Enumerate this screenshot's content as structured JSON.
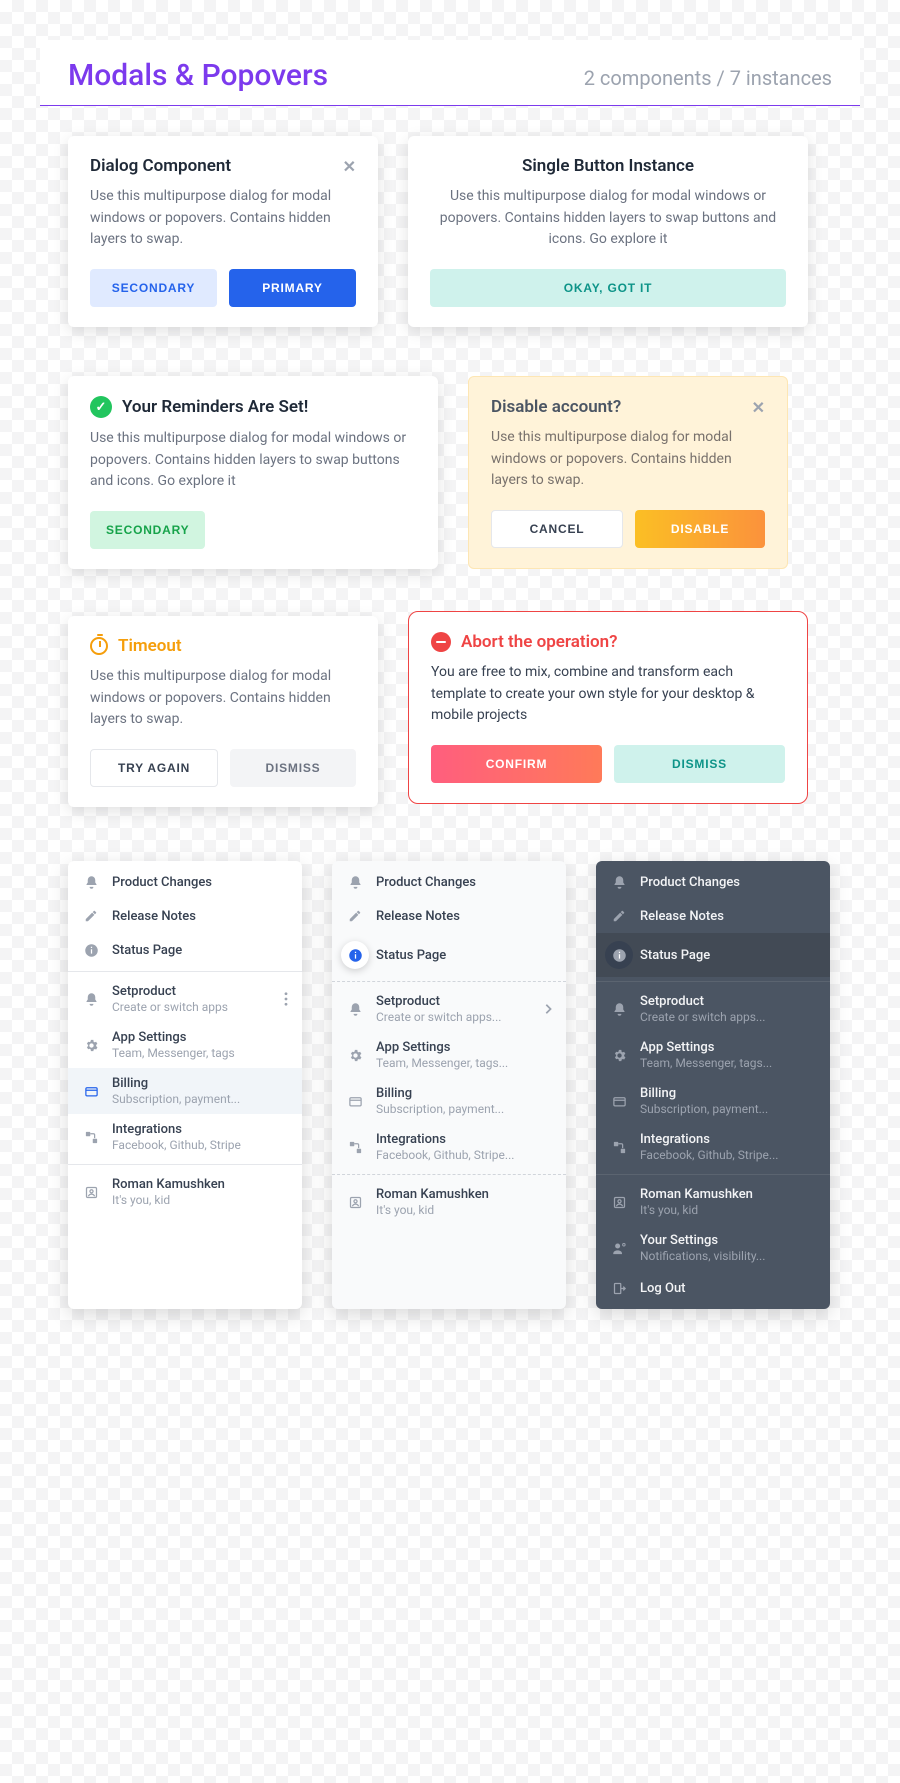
{
  "header": {
    "title": "Modals & Popovers",
    "subtitle": "2 components  / 7 instances"
  },
  "cards": {
    "dialog": {
      "title": "Dialog Component",
      "desc": "Use this multipurpose dialog for modal windows or popovers. Contains hidden layers to swap.",
      "secondary": "Secondary",
      "primary": "Primary"
    },
    "single": {
      "title": "Single Button Instance",
      "desc": "Use this multipurpose dialog for modal windows or popovers. Contains hidden layers to swap buttons and icons. Go explore it",
      "ok": "Okay, got it"
    },
    "reminders": {
      "title": "Your Reminders Are Set!",
      "desc": "Use this multipurpose dialog for modal windows or popovers. Contains hidden layers to swap buttons and icons. Go explore it",
      "secondary": "Secondary"
    },
    "disable": {
      "title": "Disable account?",
      "desc": "Use this multipurpose dialog for modal windows or popovers. Contains hidden layers to swap.",
      "cancel": "Cancel",
      "confirm": "Disable"
    },
    "timeout": {
      "title": "Timeout",
      "desc": "Use this multipurpose dialog for modal windows or popovers. Contains hidden layers to swap.",
      "retry": "Try Again",
      "dismiss": "Dismiss"
    },
    "abort": {
      "title": "Abort the operation?",
      "desc": "You are free to mix, combine and transform each template to create your own style for your desktop & mobile projects",
      "confirm": "Confirm",
      "dismiss": "Dismiss"
    }
  },
  "menu": {
    "section1": [
      {
        "icon": "bell",
        "label": "Product Changes"
      },
      {
        "icon": "edit",
        "label": "Release Notes"
      },
      {
        "icon": "info",
        "label": "Status Page",
        "selected": true
      }
    ],
    "section2": [
      {
        "icon": "bell",
        "label": "Setproduct",
        "sub_a": "Create or switch apps",
        "sub_b": "Create or switch apps...",
        "tail_a": "more",
        "tail_b": "chevron"
      },
      {
        "icon": "gear",
        "label": "App Settings",
        "sub_a": "Team, Messenger, tags",
        "sub_b": "Team, Messenger, tags..."
      },
      {
        "icon": "card",
        "label": "Billing",
        "sub": "Subscription, payment...",
        "selected_a": true
      },
      {
        "icon": "flow",
        "label": "Integrations",
        "sub_a": "Facebook, Github, Stripe",
        "sub_b": "Facebook, Github, Stripe..."
      }
    ],
    "section3": [
      {
        "icon": "user",
        "label": "Roman Kamushken",
        "sub": "It's you, kid"
      }
    ],
    "section3_dark_extra": [
      {
        "icon": "settings",
        "label": "Your Settings",
        "sub": "Notifications, visibility..."
      },
      {
        "icon": "logout",
        "label": "Log Out"
      }
    ]
  }
}
